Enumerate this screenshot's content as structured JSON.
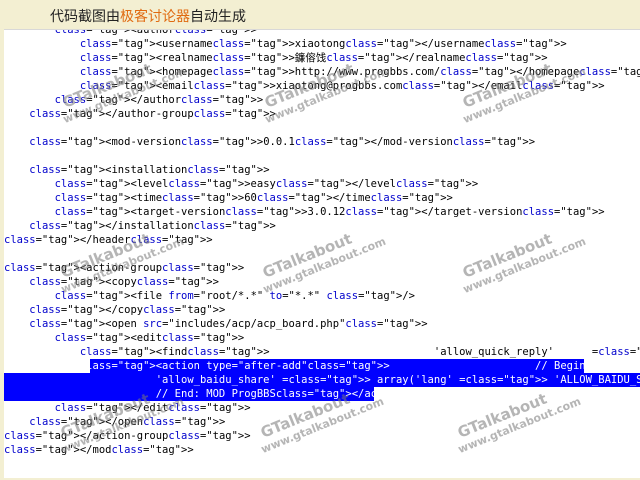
{
  "banner": {
    "prefix": "代码截图由",
    "highlight": "极客讨论器",
    "suffix": "自动生成"
  },
  "code": {
    "lines": [
      "        <author>",
      "            <username>xiaotong</username>",
      "            <realname>鐮傛饯</realname>",
      "            <homepage>http://www.progbbs.com/</homepage>",
      "            <email>xiaotong@progbbs.com</email>",
      "        </author>",
      "    </author-group>",
      "",
      "    <mod-version>0.0.1</mod-version>",
      "",
      "    <installation>",
      "        <level>easy</level>",
      "        <time>60</time>",
      "        <target-version>3.0.12</target-version>",
      "    </installation>",
      "</header>",
      "",
      "<action-group>",
      "    <copy>",
      "        <file from=\"root/*.*\" to=\"*.*\" />",
      "    </copy>",
      "    <open src=\"includes/acp/acp_board.php\">",
      "        <edit>",
      "            <find>                          'allow_quick_reply'      => array('lang' => 'ALLOW_",
      "            <action type=\"after-add\">                       // Begin: MOD ProgBBS ",
      "                        'allow_baidu_share' => array('lang' => 'ALLOW_BAIDU_SHARE', 'vali",
      "                        // End: MOD ProgBBS</action>",
      "        </edit>",
      "    </open>",
      "</action-group>",
      "</mod>"
    ],
    "selected_lines": [
      24,
      25,
      26
    ]
  },
  "watermark": {
    "name": "GTalkabout",
    "url": "www.gtalkabout.com"
  }
}
